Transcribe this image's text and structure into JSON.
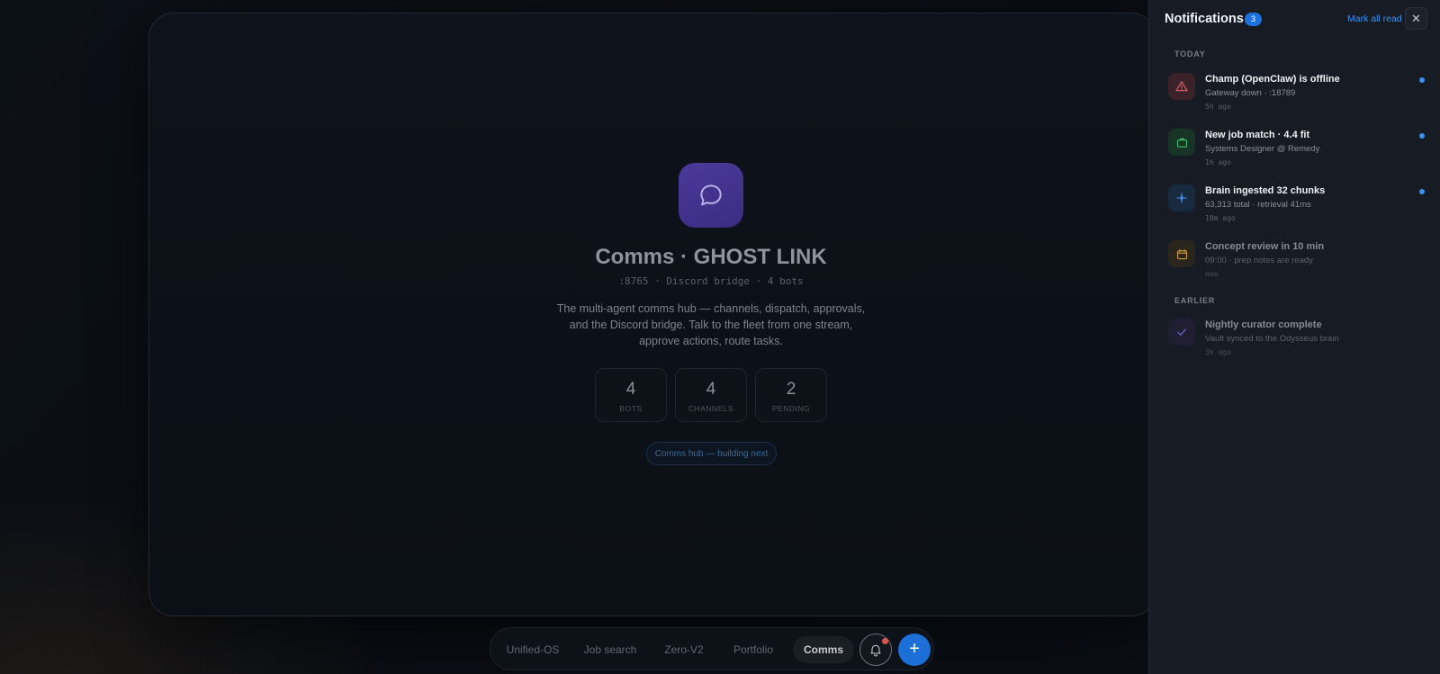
{
  "hero": {
    "title": "Comms · GHOST LINK",
    "meta": ":8765 · Discord bridge · 4 bots",
    "description": "The multi-agent comms hub — channels, dispatch, approvals, and the Discord bridge. Talk to the fleet from one stream, approve actions, route tasks.",
    "icon": "chat-bubble-icon",
    "stats": [
      {
        "value": "4",
        "label": "BOTS"
      },
      {
        "value": "4",
        "label": "CHANNELS"
      },
      {
        "value": "2",
        "label": "PENDING"
      }
    ],
    "chip_label": "Comms hub — building next"
  },
  "nav": {
    "tabs": [
      {
        "label": "Unified-OS"
      },
      {
        "label": "Job search"
      },
      {
        "label": "Zero-V2"
      },
      {
        "label": "Portfolio"
      },
      {
        "label": "Comms"
      }
    ],
    "active_tab": "Comms",
    "plus_label": "+"
  },
  "notifications": {
    "title": "Notifications",
    "count": "3",
    "mark_all_label": "Mark all read",
    "close_label": "✕",
    "sections": {
      "today": "TODAY",
      "earlier": "EARLIER"
    },
    "items": [
      {
        "title": "Champ (OpenClaw) is offline",
        "subtitle": "Gateway down · :18789",
        "time": "5h ago",
        "icon": "warning-triangle-icon",
        "unread": true,
        "color": "#e0606a"
      },
      {
        "title": "New job match · 4.4 fit",
        "subtitle": "Systems Designer @ Remedy",
        "time": "1h ago",
        "icon": "briefcase-icon",
        "unread": true,
        "color": "#3fbf6f"
      },
      {
        "title": "Brain ingested 32 chunks",
        "subtitle": "63,313 total · retrieval 41ms",
        "time": "18m ago",
        "icon": "sparkle-icon",
        "unread": true,
        "color": "#4a8fe8"
      },
      {
        "title": "Concept review in 10 min",
        "subtitle": "09:00 · prep notes are ready",
        "time": "now",
        "icon": "calendar-icon",
        "unread": false,
        "color": "#c9973e"
      },
      {
        "title": "Nightly curator complete",
        "subtitle": "Vault synced to the Odysseus brain",
        "time": "3h ago",
        "icon": "check-icon",
        "unread": false,
        "color": "#7a6cd8"
      }
    ]
  }
}
